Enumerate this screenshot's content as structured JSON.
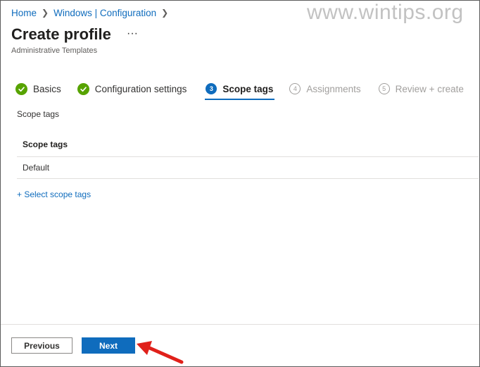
{
  "breadcrumb": {
    "items": [
      {
        "label": "Home"
      },
      {
        "label": "Windows | Configuration"
      }
    ]
  },
  "watermark": {
    "text": "www.wintips.org"
  },
  "header": {
    "title": "Create profile",
    "more_label": "···",
    "subtitle": "Administrative Templates"
  },
  "wizard": {
    "steps": [
      {
        "label": "Basics",
        "state": "done"
      },
      {
        "label": "Configuration settings",
        "state": "done"
      },
      {
        "number": "3",
        "label": "Scope tags",
        "state": "current"
      },
      {
        "number": "4",
        "label": "Assignments",
        "state": "future"
      },
      {
        "number": "5",
        "label": "Review + create",
        "state": "future"
      }
    ]
  },
  "scope": {
    "section_label": "Scope tags",
    "table": {
      "header": "Scope tags",
      "rows": [
        "Default"
      ]
    },
    "select_link": "+ Select scope tags"
  },
  "footer": {
    "previous_label": "Previous",
    "next_label": "Next"
  },
  "colors": {
    "accent": "#0f6cbd",
    "success": "#57a300",
    "annotation_arrow": "#e0201a"
  }
}
